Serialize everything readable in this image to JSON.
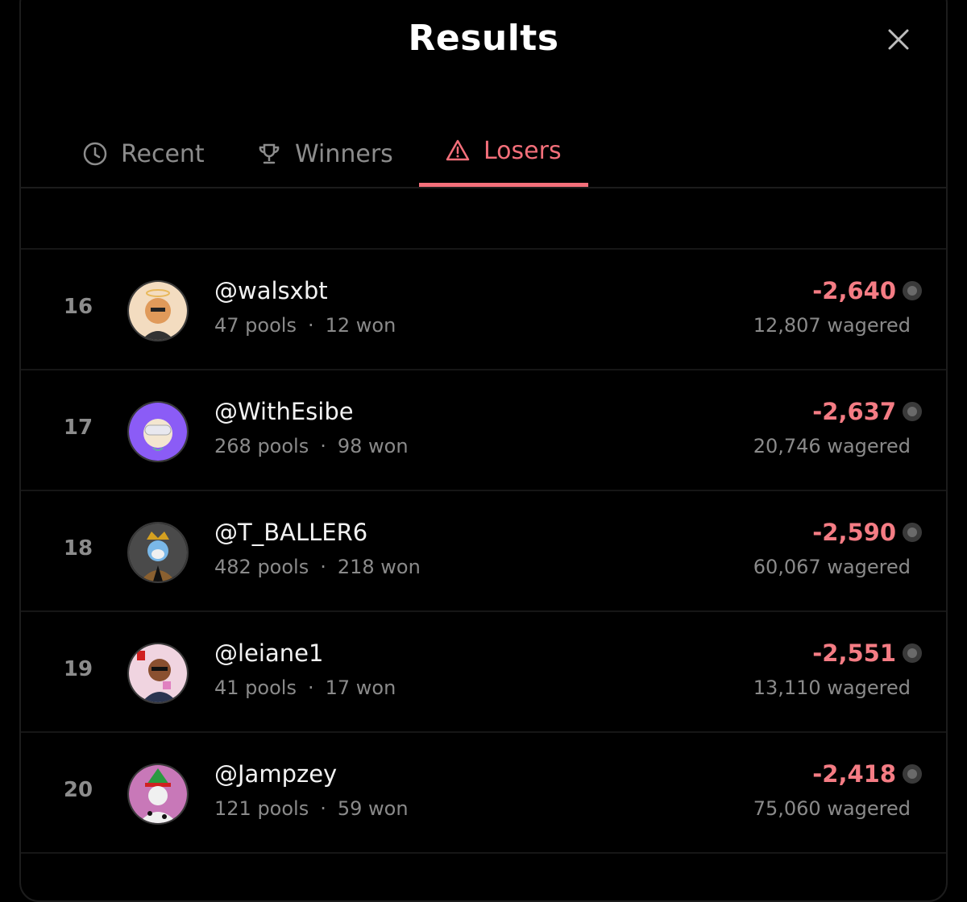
{
  "header": {
    "title": "Results"
  },
  "tabs": [
    {
      "label": "Recent",
      "icon": "clock-icon",
      "active": false
    },
    {
      "label": "Winners",
      "icon": "trophy-icon",
      "active": false
    },
    {
      "label": "Losers",
      "icon": "warning-icon",
      "active": true
    }
  ],
  "colors": {
    "accent": "#f36f7a",
    "loss_amount": "#f47c84",
    "muted_text": "#8a8a8a",
    "background": "#000000"
  },
  "rows": [
    {
      "rank": "16",
      "handle": "@walsxbt",
      "pools": "47 pools",
      "won": "12 won",
      "amount": "-2,640",
      "wagered": "12,807 wagered",
      "avatar_color": "#f3dcc0"
    },
    {
      "rank": "17",
      "handle": "@WithEsibe",
      "pools": "268 pools",
      "won": "98 won",
      "amount": "-2,637",
      "wagered": "20,746 wagered",
      "avatar_color": "#8b5cf6"
    },
    {
      "rank": "18",
      "handle": "@T_BALLER6",
      "pools": "482 pools",
      "won": "218 won",
      "amount": "-2,590",
      "wagered": "60,067 wagered",
      "avatar_color": "#4a4a4a"
    },
    {
      "rank": "19",
      "handle": "@leiane1",
      "pools": "41 pools",
      "won": "17 won",
      "amount": "-2,551",
      "wagered": "13,110 wagered",
      "avatar_color": "#f0d4e0"
    },
    {
      "rank": "20",
      "handle": "@Jampzey",
      "pools": "121 pools",
      "won": "59 won",
      "amount": "-2,418",
      "wagered": "75,060 wagered",
      "avatar_color": "#c878b8"
    }
  ]
}
